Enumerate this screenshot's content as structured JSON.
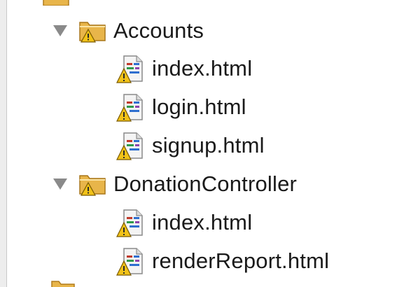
{
  "tree": {
    "groups": [
      {
        "label": "Accounts",
        "expanded": true,
        "files": [
          "index.html",
          "login.html",
          "signup.html"
        ]
      },
      {
        "label": "DonationController",
        "expanded": true,
        "files": [
          "index.html",
          "renderReport.html"
        ]
      }
    ]
  },
  "icons": {
    "expand": "triangle-down-icon",
    "folder": "folder-warning-icon",
    "file": "html-file-warning-icon"
  },
  "colors": {
    "folder": "#e8b54a",
    "warning": "#f2c218",
    "file_page": "#f4f4f4",
    "twisty": "#8a8a8a"
  }
}
